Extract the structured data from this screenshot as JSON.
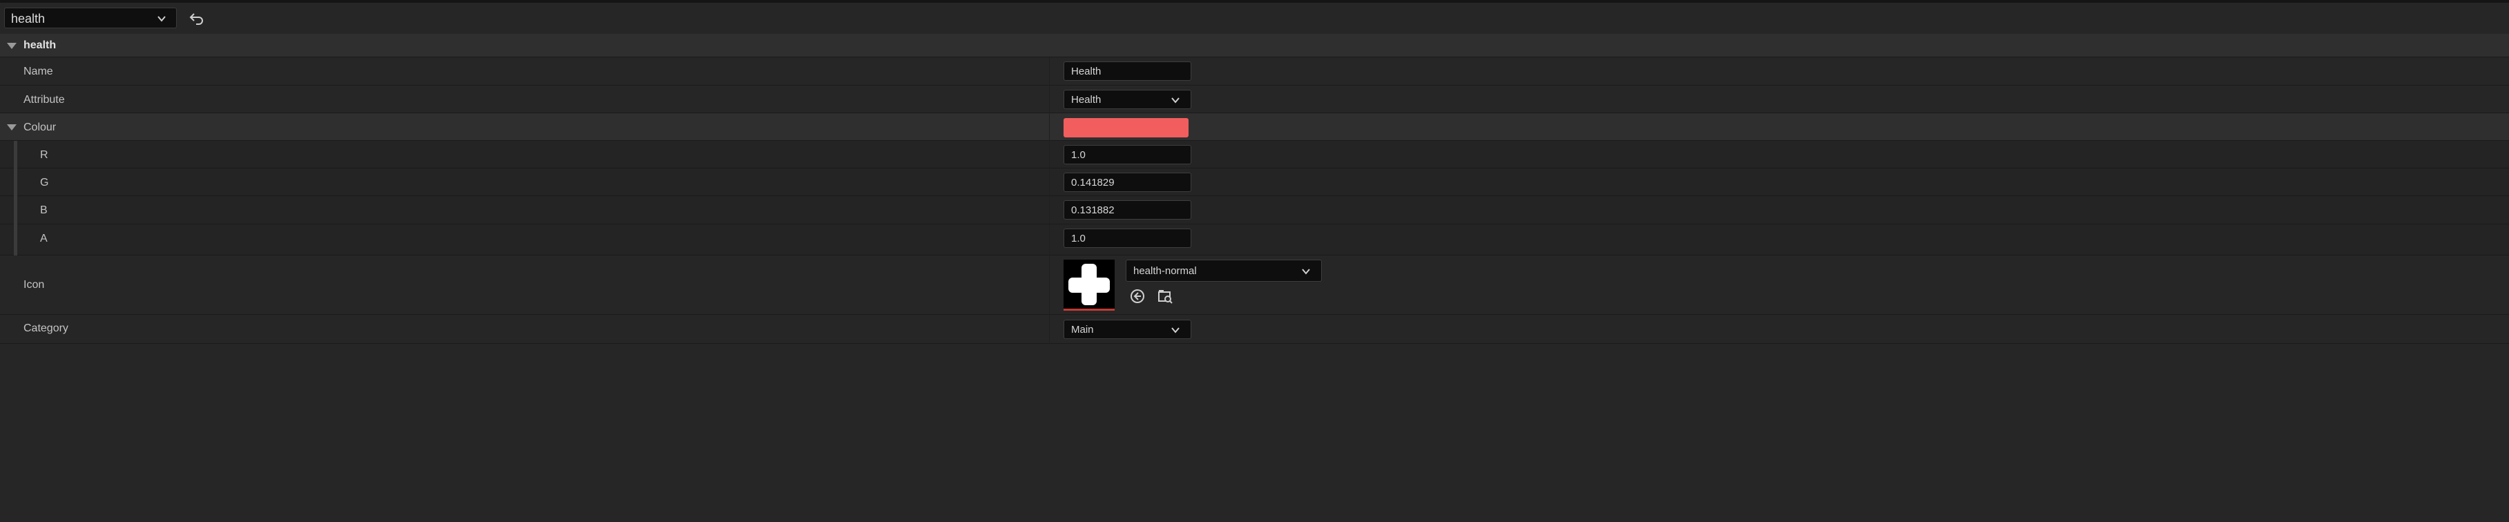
{
  "toolbar": {
    "asset_selector_value": "health",
    "dropdown_icon": "chevron-down-icon",
    "back_icon": "undo-arrow-icon"
  },
  "section": {
    "title": "health"
  },
  "properties": {
    "name": {
      "label": "Name",
      "value": "Health"
    },
    "attribute": {
      "label": "Attribute",
      "value": "Health"
    },
    "colour": {
      "label": "Colour",
      "swatch_color": "#f25d5d",
      "r": {
        "label": "R",
        "value": "1.0"
      },
      "g": {
        "label": "G",
        "value": "0.141829"
      },
      "b": {
        "label": "B",
        "value": "0.131882"
      },
      "a": {
        "label": "A",
        "value": "1.0"
      }
    },
    "icon": {
      "label": "Icon",
      "value": "health-normal",
      "thumbnail": "white-plus-cross-icon",
      "reset_icon": "reset-circle-arrow-icon",
      "browse_icon": "browse-folder-icon"
    },
    "category": {
      "label": "Category",
      "value": "Main"
    }
  },
  "colors": {
    "background": "#262626",
    "section_background": "#2f2f2f",
    "field_background": "#0e0e0e",
    "thumbnail_accent": "#c23a32"
  }
}
